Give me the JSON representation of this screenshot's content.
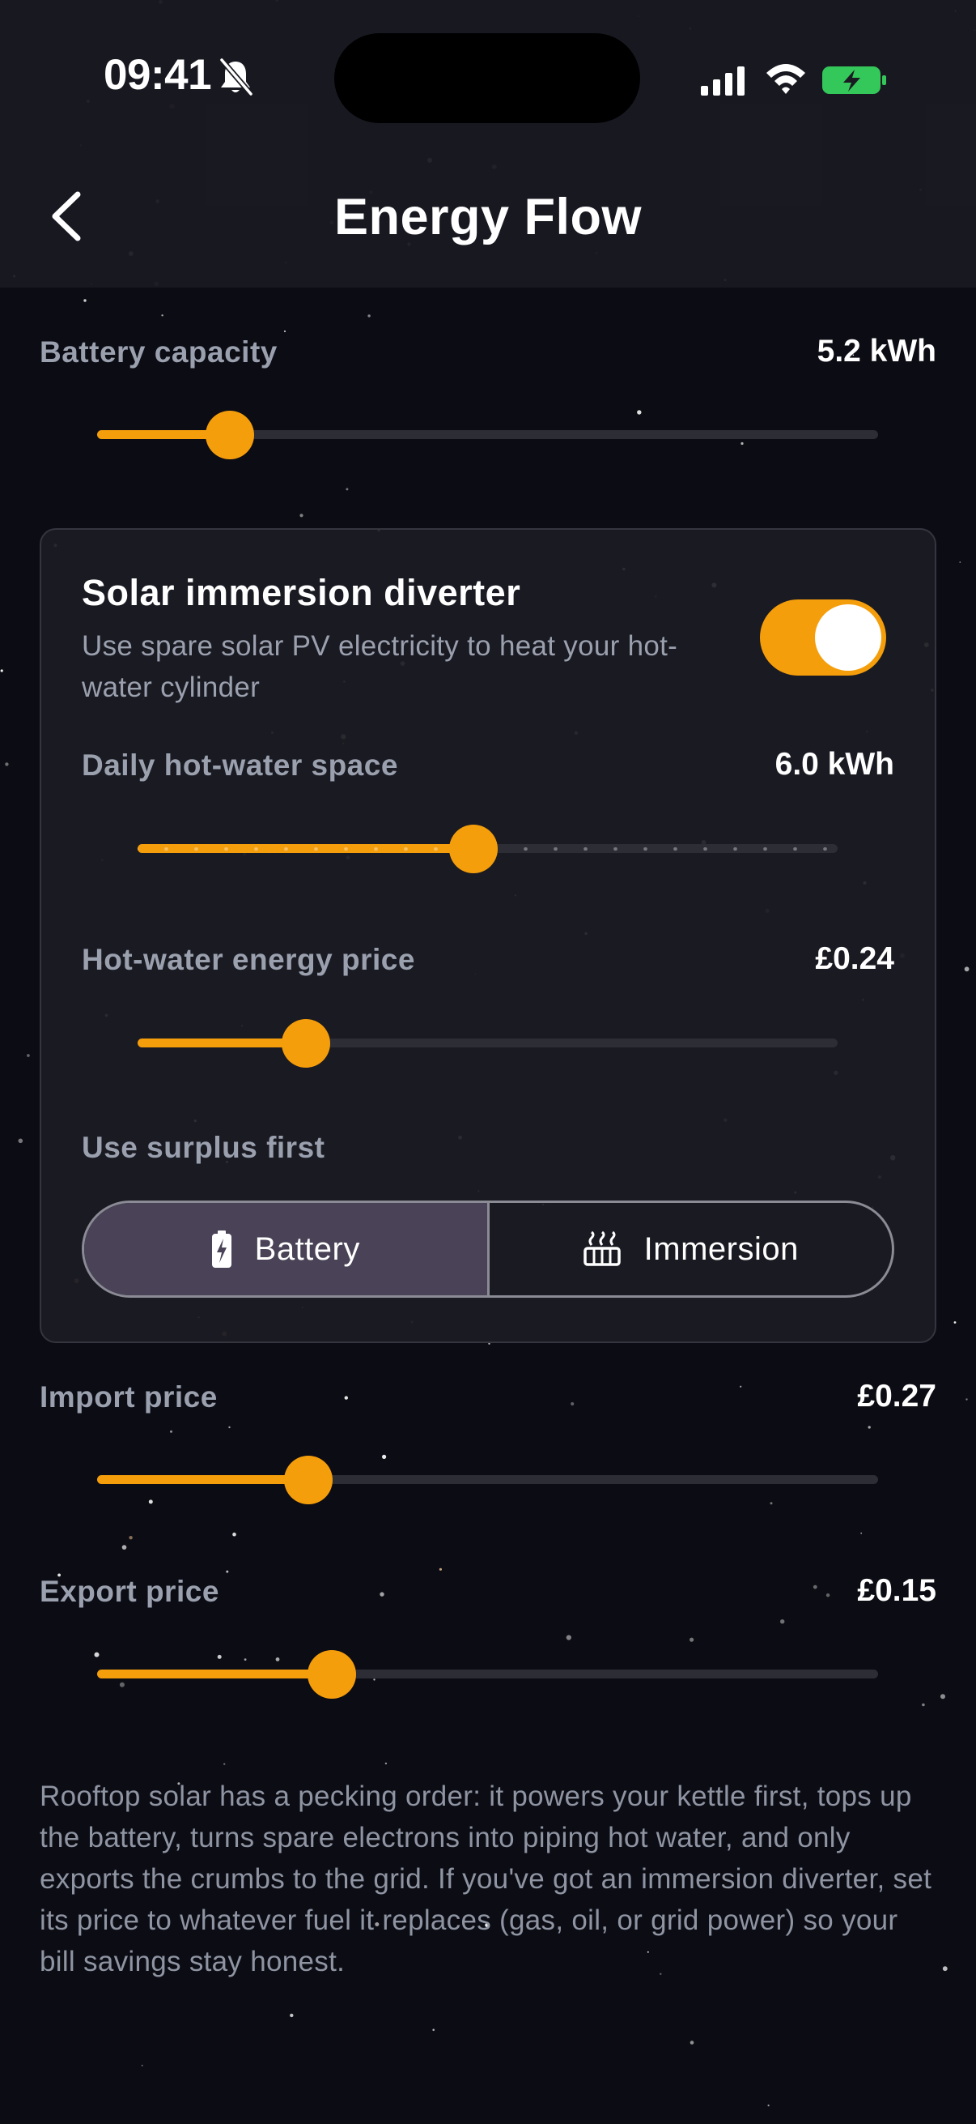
{
  "status_bar": {
    "time": "09:41"
  },
  "header": {
    "title": "Energy Flow"
  },
  "battery_capacity": {
    "label": "Battery capacity",
    "value": "5.2 kWh",
    "fraction": 0.17
  },
  "diverter": {
    "title": "Solar immersion diverter",
    "description": "Use spare solar PV electricity to heat your hot-water cylinder",
    "enabled": true,
    "daily_space": {
      "label": "Daily hot-water space",
      "value": "6.0 kWh",
      "fraction": 0.48
    },
    "energy_price": {
      "label": "Hot-water energy price",
      "value": "£0.24",
      "fraction": 0.24
    },
    "surplus": {
      "label": "Use surplus first",
      "options": [
        {
          "label": "Battery",
          "icon": "battery-icon",
          "selected": true
        },
        {
          "label": "Immersion",
          "icon": "heater-icon",
          "selected": false
        }
      ]
    }
  },
  "import_price": {
    "label": "Import price",
    "value": "£0.27",
    "fraction": 0.27
  },
  "export_price": {
    "label": "Export price",
    "value": "£0.15",
    "fraction": 0.3
  },
  "footnote": "Rooftop solar has a pecking order: it powers your kettle first, tops up the battery, turns spare electrons into piping hot water, and only exports the crumbs to the grid. If you've got an immersion diverter, set its price to whatever fuel it replaces (gas, oil, or grid power) so your bill savings stay honest.",
  "colors": {
    "accent": "#f59e0b",
    "background": "#0c0c14",
    "card": "#1c1c24",
    "segment_active": "#4a4357",
    "battery_charging": "#34c759"
  }
}
